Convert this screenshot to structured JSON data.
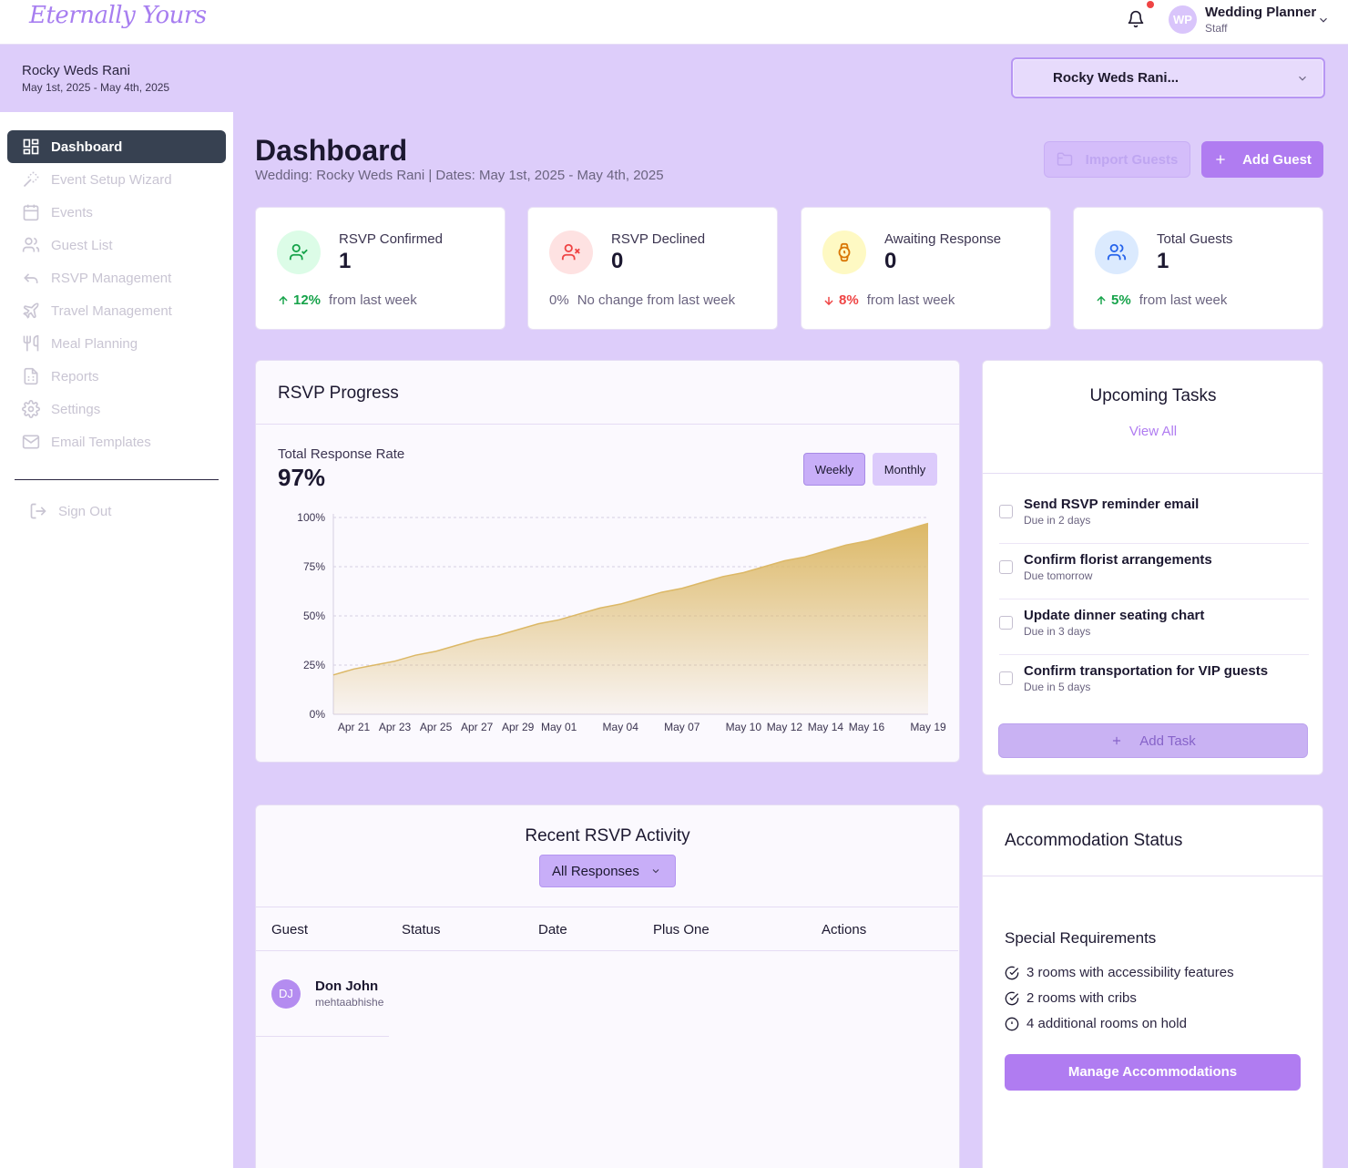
{
  "app": {
    "logo": "Eternally Yours"
  },
  "user": {
    "initials": "WP",
    "name": "Wedding Planner",
    "role": "Staff"
  },
  "wedding": {
    "name": "Rocky Weds Rani",
    "dates": "May 1st, 2025 - May 4th, 2025",
    "selector_value": "Rocky Weds Rani..."
  },
  "sidebar": {
    "items": [
      {
        "label": "Dashboard",
        "icon": "grid-icon"
      },
      {
        "label": "Event Setup Wizard",
        "icon": "wand-icon"
      },
      {
        "label": "Events",
        "icon": "calendar-icon"
      },
      {
        "label": "Guest List",
        "icon": "users-icon"
      },
      {
        "label": "RSVP Management",
        "icon": "reply-icon"
      },
      {
        "label": "Travel Management",
        "icon": "plane-icon"
      },
      {
        "label": "Meal Planning",
        "icon": "utensils-icon"
      },
      {
        "label": "Reports",
        "icon": "file-icon"
      },
      {
        "label": "Settings",
        "icon": "gear-icon"
      },
      {
        "label": "Email Templates",
        "icon": "mail-icon"
      }
    ],
    "sign_out": "Sign Out"
  },
  "header": {
    "title": "Dashboard",
    "subtitle": "Wedding: Rocky Weds Rani | Dates: May 1st, 2025 - May 4th, 2025",
    "import_label": "Import Guests",
    "add_label": "Add Guest"
  },
  "stats": [
    {
      "label": "RSVP Confirmed",
      "value": "1",
      "pct": "12%",
      "foot": "from last week",
      "trend": "up",
      "color": "#16a34a",
      "bg": "#dcfce7"
    },
    {
      "label": "RSVP Declined",
      "value": "0",
      "pct": "0%",
      "foot": "No change from last week",
      "trend": "none",
      "color": "#ef4444",
      "bg": "#fee2e2"
    },
    {
      "label": "Awaiting Response",
      "value": "0",
      "pct": "8%",
      "foot": "from last week",
      "trend": "down",
      "color": "#d97706",
      "bg": "#fef9c3"
    },
    {
      "label": "Total Guests",
      "value": "1",
      "pct": "5%",
      "foot": "from last week",
      "trend": "up",
      "color": "#2563eb",
      "bg": "#dbeafe"
    }
  ],
  "rsvp_progress": {
    "title": "RSVP Progress",
    "rate_label": "Total Response Rate",
    "rate_value": "97%",
    "toggle_weekly": "Weekly",
    "toggle_monthly": "Monthly"
  },
  "chart_data": {
    "type": "area",
    "title": "",
    "xlabel": "",
    "ylabel": "",
    "x_ticks": [
      "Apr 21",
      "Apr 23",
      "Apr 25",
      "Apr 27",
      "Apr 29",
      "May 01",
      "May 04",
      "May 07",
      "May 10",
      "May 12",
      "May 14",
      "May 16",
      "May 19"
    ],
    "y_ticks": [
      "0%",
      "25%",
      "50%",
      "75%",
      "100%"
    ],
    "ylim": [
      0,
      100
    ],
    "series": [
      {
        "x": [
          "Apr 20",
          "Apr 21",
          "Apr 22",
          "Apr 23",
          "Apr 24",
          "Apr 25",
          "Apr 26",
          "Apr 27",
          "Apr 28",
          "Apr 29",
          "Apr 30",
          "May 01",
          "May 02",
          "May 03",
          "May 04",
          "May 05",
          "May 06",
          "May 07",
          "May 08",
          "May 09",
          "May 10",
          "May 11",
          "May 12",
          "May 13",
          "May 14",
          "May 15",
          "May 16",
          "May 17",
          "May 18",
          "May 19"
        ],
        "values": [
          20,
          23,
          25,
          27,
          30,
          32,
          35,
          38,
          40,
          43,
          46,
          48,
          51,
          54,
          56,
          59,
          62,
          64,
          67,
          70,
          72,
          75,
          78,
          80,
          83,
          86,
          88,
          91,
          94,
          97
        ]
      }
    ],
    "grid": true,
    "color": "#dcb866"
  },
  "tasks": {
    "title": "Upcoming Tasks",
    "view_all": "View All",
    "items": [
      {
        "title": "Send RSVP reminder email",
        "due": "Due in 2 days"
      },
      {
        "title": "Confirm florist arrangements",
        "due": "Due tomorrow"
      },
      {
        "title": "Update dinner seating chart",
        "due": "Due in 3 days"
      },
      {
        "title": "Confirm transportation for VIP guests",
        "due": "Due in 5 days"
      }
    ],
    "add_label": "Add Task"
  },
  "activity": {
    "title": "Recent RSVP Activity",
    "filter": "All Responses",
    "columns": [
      "Guest",
      "Status",
      "Date",
      "Plus One",
      "Actions"
    ],
    "rows": [
      {
        "initials": "DJ",
        "name": "Don John",
        "email": "mehtaabhishe"
      }
    ]
  },
  "accommodation": {
    "title": "Accommodation Status",
    "req_title": "Special Requirements",
    "items": [
      {
        "text": "3 rooms with accessibility features",
        "icon": "check-circle-icon"
      },
      {
        "text": "2 rooms with cribs",
        "icon": "check-circle-icon"
      },
      {
        "text": "4 additional rooms on hold",
        "icon": "alert-circle-icon"
      }
    ],
    "manage_label": "Manage Accommodations"
  }
}
